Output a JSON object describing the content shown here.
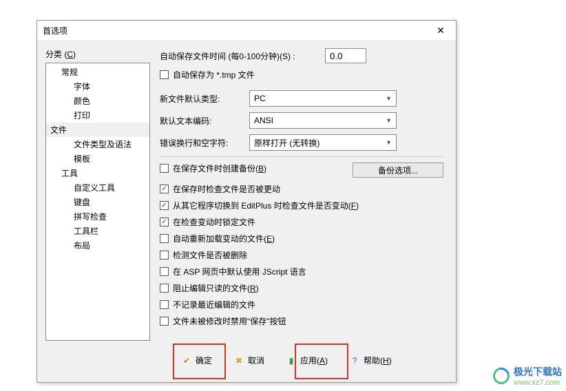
{
  "dialog": {
    "title": "首选项",
    "categoryLabel": "分类 (C)",
    "closeSymbol": "✕"
  },
  "tree": {
    "items": [
      {
        "label": "常规",
        "level": 1
      },
      {
        "label": "字体",
        "level": 2
      },
      {
        "label": "颜色",
        "level": 2
      },
      {
        "label": "打印",
        "level": 2
      },
      {
        "label": "文件",
        "level": "sel"
      },
      {
        "label": "文件类型及语法",
        "level": 2
      },
      {
        "label": "模板",
        "level": 2
      },
      {
        "label": "工具",
        "level": 1
      },
      {
        "label": "自定义工具",
        "level": 2
      },
      {
        "label": "键盘",
        "level": 2
      },
      {
        "label": "拼写检查",
        "level": 2
      },
      {
        "label": "工具栏",
        "level": 2
      },
      {
        "label": "布局",
        "level": 2
      }
    ]
  },
  "main": {
    "autosaveLabel": "自动保存文件时间 (每0-100分钟)(S) :",
    "autosaveValue": "0.0",
    "autosaveTmp": "自动保存为 *.tmp 文件",
    "newFileTypeLabel": "新文件默认类型:",
    "newFileTypeValue": "PC",
    "defaultEncodingLabel": "默认文本编码:",
    "defaultEncodingValue": "ANSI",
    "wrongLineLabel": "错误换行和空字符:",
    "wrongLineValue": "原样打开 (无转换)",
    "backupOptions": "备份选项...",
    "checks": [
      {
        "label": "在保存文件时创建备份(B)",
        "checked": false,
        "u": "B"
      },
      {
        "label": "在保存时检查文件是否被更动",
        "checked": true
      },
      {
        "label": "从其它程序切换到 EditPlus 时检查文件是否变动(F)",
        "checked": true,
        "u": "F"
      },
      {
        "label": "在检查变动时锁定文件",
        "checked": true
      },
      {
        "label": "自动重新加载变动的文件(E)",
        "checked": false,
        "u": "E"
      },
      {
        "label": "检测文件是否被删除",
        "checked": false
      },
      {
        "label": "在 ASP 网页中默认使用 JScript 语言",
        "checked": false
      },
      {
        "label": "阻止编辑只读的文件(R)",
        "checked": false,
        "u": "R"
      },
      {
        "label": "不记录最近编辑的文件",
        "checked": false
      },
      {
        "label": "文件未被修改时禁用\"保存\"按钮",
        "checked": false
      }
    ]
  },
  "buttons": {
    "ok": "确定",
    "cancel": "取消",
    "apply": "应用(A)",
    "help": "帮助(H)"
  },
  "logo": {
    "text": "极光下载站",
    "url": "www.xz7.com"
  }
}
